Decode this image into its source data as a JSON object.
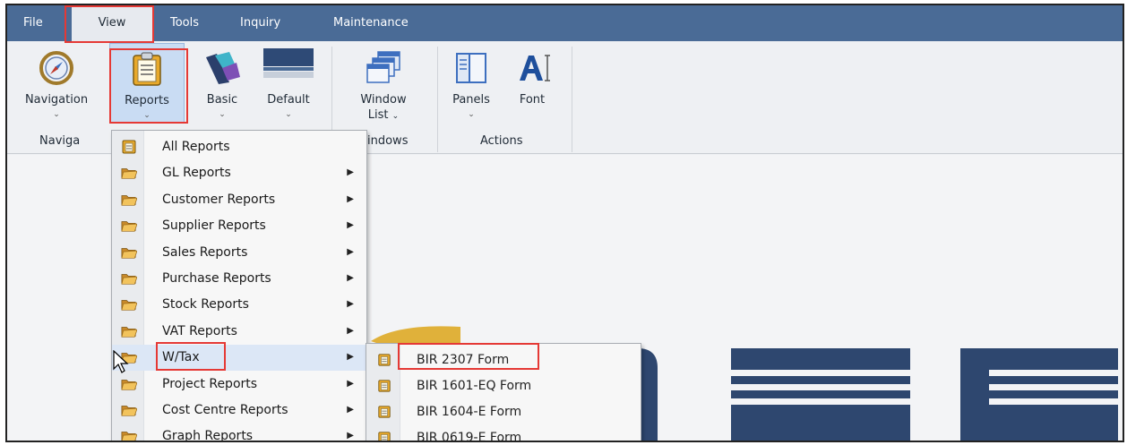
{
  "menubar": {
    "items": [
      {
        "label": "File"
      },
      {
        "label": "View"
      },
      {
        "label": "Tools"
      },
      {
        "label": "Inquiry"
      },
      {
        "label": "Maintenance"
      }
    ]
  },
  "ribbon": {
    "buttons": {
      "navigation": {
        "label": "Navigation",
        "icon": "compass-icon"
      },
      "reports": {
        "label": "Reports",
        "icon": "clipboard-icon"
      },
      "basic": {
        "label": "Basic",
        "icon": "theme-basic-icon"
      },
      "default": {
        "label": "Default",
        "icon": "theme-default-icon"
      },
      "window_list": {
        "label_line1": "Window",
        "label_line2": "List",
        "icon": "windows-stack-icon"
      },
      "panels": {
        "label": "Panels",
        "icon": "panels-icon"
      },
      "font": {
        "label": "Font",
        "icon": "font-icon"
      }
    },
    "groups": {
      "navigation": "Naviga",
      "windows": "indows",
      "actions": "Actions"
    }
  },
  "reports_menu": {
    "items": [
      {
        "label": "All Reports",
        "icon": "clipboard-icon",
        "submenu": false
      },
      {
        "label": "GL Reports",
        "icon": "folder-icon",
        "submenu": true
      },
      {
        "label": "Customer Reports",
        "icon": "folder-icon",
        "submenu": true
      },
      {
        "label": "Supplier Reports",
        "icon": "folder-icon",
        "submenu": true
      },
      {
        "label": "Sales Reports",
        "icon": "folder-icon",
        "submenu": true
      },
      {
        "label": "Purchase Reports",
        "icon": "folder-icon",
        "submenu": true
      },
      {
        "label": "Stock Reports",
        "icon": "folder-icon",
        "submenu": true
      },
      {
        "label": "VAT Reports",
        "icon": "folder-icon",
        "submenu": true
      },
      {
        "label": "W/Tax",
        "icon": "folder-icon",
        "submenu": true
      },
      {
        "label": "Project Reports",
        "icon": "folder-icon",
        "submenu": true
      },
      {
        "label": "Cost Centre Reports",
        "icon": "folder-icon",
        "submenu": true
      },
      {
        "label": "Graph Reports",
        "icon": "folder-icon",
        "submenu": true
      }
    ]
  },
  "wtax_submenu": {
    "items": [
      {
        "label": "BIR 2307 Form",
        "icon": "clipboard-icon"
      },
      {
        "label": "BIR 1601-EQ Form",
        "icon": "clipboard-icon"
      },
      {
        "label": "BIR 1604-E Form",
        "icon": "clipboard-icon"
      },
      {
        "label": "BIR 0619-E Form",
        "icon": "clipboard-icon"
      }
    ]
  },
  "colors": {
    "menubar_bg": "#4a6b96",
    "highlight_box": "#e53935",
    "logo_navy": "#2e476f",
    "logo_gold": "#e0b13a"
  }
}
